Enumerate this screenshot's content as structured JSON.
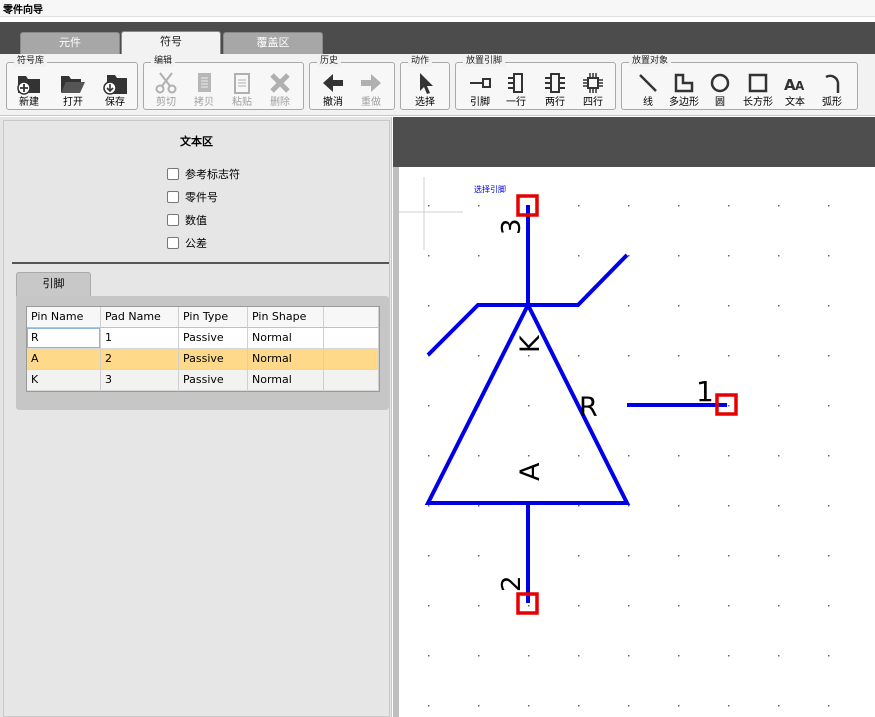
{
  "window": {
    "title": "零件向导"
  },
  "tabs": [
    {
      "label": "元件",
      "active": false
    },
    {
      "label": "符号",
      "active": true
    },
    {
      "label": "覆盖区",
      "active": false
    }
  ],
  "toolbar": {
    "groups": [
      {
        "label": "符号库",
        "items": [
          {
            "label": "新建",
            "icon": "new-folder-icon",
            "enabled": true
          },
          {
            "label": "打开",
            "icon": "open-folder-icon",
            "enabled": true
          },
          {
            "label": "保存",
            "icon": "save-folder-icon",
            "enabled": true
          }
        ]
      },
      {
        "label": "编辑",
        "items": [
          {
            "label": "剪切",
            "icon": "scissors-icon",
            "enabled": false
          },
          {
            "label": "拷贝",
            "icon": "copy-icon",
            "enabled": false
          },
          {
            "label": "粘贴",
            "icon": "paste-icon",
            "enabled": false
          },
          {
            "label": "删除",
            "icon": "delete-x-icon",
            "enabled": false
          }
        ]
      },
      {
        "label": "历史",
        "items": [
          {
            "label": "撤消",
            "icon": "undo-arrow-icon",
            "enabled": true
          },
          {
            "label": "重做",
            "icon": "redo-arrow-icon",
            "enabled": false
          }
        ]
      },
      {
        "label": "动作",
        "items": [
          {
            "label": "选择",
            "icon": "pointer-arrow-icon",
            "enabled": true
          }
        ]
      },
      {
        "label": "放置引脚",
        "items": [
          {
            "label": "引脚",
            "icon": "pin-icon",
            "enabled": true
          },
          {
            "label": "一行",
            "icon": "one-row-pins-icon",
            "enabled": true
          },
          {
            "label": "两行",
            "icon": "two-row-pins-icon",
            "enabled": true
          },
          {
            "label": "四行",
            "icon": "four-row-pins-icon",
            "enabled": true
          }
        ]
      },
      {
        "label": "放置对象",
        "items": [
          {
            "label": "线",
            "icon": "line-icon",
            "enabled": true
          },
          {
            "label": "多边形",
            "icon": "polygon-icon",
            "enabled": true
          },
          {
            "label": "圆",
            "icon": "circle-icon",
            "enabled": true
          },
          {
            "label": "长方形",
            "icon": "rectangle-icon",
            "enabled": true
          },
          {
            "label": "文本",
            "icon": "text-aa-icon",
            "enabled": true
          },
          {
            "label": "弧形",
            "icon": "arc-icon",
            "enabled": true
          }
        ]
      }
    ]
  },
  "text_area": {
    "title": "文本区",
    "checkboxes": [
      {
        "label": "参考标志符",
        "checked": false
      },
      {
        "label": "零件号",
        "checked": false
      },
      {
        "label": "数值",
        "checked": false
      },
      {
        "label": "公差",
        "checked": false
      }
    ]
  },
  "pins": {
    "tab_label": "引脚",
    "columns": [
      "Pin Name",
      "Pad Name",
      "Pin Type",
      "Pin Shape",
      ""
    ],
    "rows": [
      [
        "R",
        "1",
        "Passive",
        "Normal",
        ""
      ],
      [
        "A",
        "2",
        "Passive",
        "Normal",
        ""
      ],
      [
        "K",
        "3",
        "Passive",
        "Normal",
        ""
      ]
    ],
    "selected_row": 1
  },
  "canvas": {
    "hint": "选择引脚",
    "pin_labels": [
      "1",
      "2",
      "3"
    ],
    "body_labels": [
      "K",
      "R",
      "A"
    ],
    "symbol_color": "#0000e6",
    "pin_box_color": "#e60000"
  }
}
